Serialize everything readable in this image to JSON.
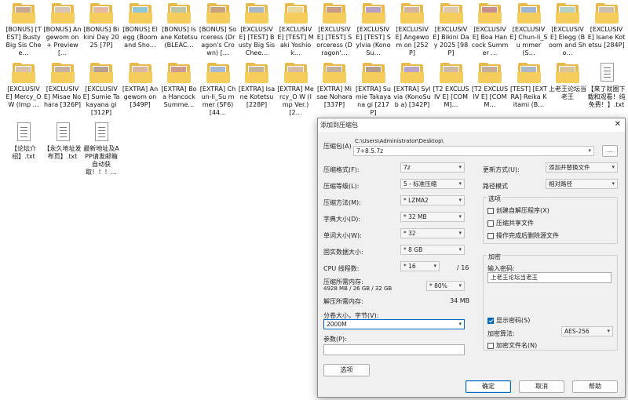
{
  "desktop": {
    "row1": [
      {
        "label": "[BONUS] [TEST] Busty Big Sis Chee…",
        "type": "folder",
        "photo": "#c9a993"
      },
      {
        "label": "[BONUS] Angewom on + Preview[…",
        "type": "folder",
        "photo": "#d7c4b6"
      },
      {
        "label": "[BONUS] Bikini Day 2025 [7P]",
        "type": "folder",
        "photo": "#e6b9a6"
      },
      {
        "label": "[BONUS] Elegg (Boom and Sho…",
        "type": "folder",
        "photo": "#8fc6d8"
      },
      {
        "label": "[BONUS] Isane Kotetsu (BLEAC…",
        "type": "folder",
        "photo": "#b9c7a8"
      },
      {
        "label": "[BONUS] Sorceress (Dragon's Crown) […",
        "type": "folder",
        "photo": "#c8a27f"
      },
      {
        "label": "[EXCLUSIV E] [TEST] Busty Big Sis Chee…",
        "type": "folder",
        "photo": "#a8b7c9"
      },
      {
        "label": "[EXCLUSIV E] [TEST] Maki Yoshiok…",
        "type": "folder",
        "photo": "#e9d7a0"
      },
      {
        "label": "[EXCLUSIV E] [TEST] Sorceress (Dragon'…",
        "type": "folder",
        "photo": "#c79a86"
      },
      {
        "label": "[EXCLUSIV E] [TEST] Sylvia (KonoSu…",
        "type": "folder",
        "photo": "#b7a0c6"
      },
      {
        "label": "[EXCLUSIV E] Angewom on [252P]",
        "type": "folder",
        "photo": "#d6b3a1"
      },
      {
        "label": "[EXCLUSIV E] Bikini Day 2025 [98P]",
        "type": "folder",
        "photo": "#e0c7b0"
      },
      {
        "label": "[EXCLUSIV E] Boa Hancock Summer …",
        "type": "folder",
        "photo": "#c98f8f"
      },
      {
        "label": "[EXCLUSIV E] Chun-li_Su mmer (S…",
        "type": "folder",
        "photo": "#9fb5d4"
      },
      {
        "label": "[EXCLUSIV E] Elegg (Boom and Sho…",
        "type": "folder",
        "photo": "#b4d2c8"
      },
      {
        "label": "[EXCLUSIV E] Isane Kotetsu [284P]",
        "type": "folder",
        "photo": "#cdbfae"
      }
    ],
    "row2": [
      {
        "label": "[EXCLUSIV E] Mercy_O W (Imp …",
        "type": "folder",
        "photo": "#d8c0a8"
      },
      {
        "label": "[EXCLUSIV E] Misae Nohara [326P]",
        "type": "folder",
        "photo": "#c6b1a0"
      },
      {
        "label": "[EXCLUSIV E] Sumie Takayana gi [312P]",
        "type": "folder",
        "photo": "#b79f94"
      },
      {
        "label": "[EXTRA] Angewom on [349P]",
        "type": "folder",
        "photo": "#d9b6a3"
      },
      {
        "label": "[EXTRA] Boa Hancock Summe…",
        "type": "folder",
        "photo": "#cc9a8e"
      },
      {
        "label": "[EXTRA] Chun-li_Su mmer (SF6) [44…",
        "type": "folder",
        "photo": "#a6b9d2"
      },
      {
        "label": "[EXTRA] Isane Kotetsu [228P]",
        "type": "folder",
        "photo": "#c3b49e"
      },
      {
        "label": "[EXTRA] Mercy_O W (Imp Ver.) [2…",
        "type": "folder",
        "photo": "#d4bca6"
      },
      {
        "label": "[EXTRA] Misae Nohara [337P]",
        "type": "folder",
        "photo": "#c2ad9c"
      },
      {
        "label": "[EXTRA] Sumie Takayana gi [217P]",
        "type": "folder",
        "photo": "#b59c90"
      },
      {
        "label": "[EXTRA] Sylvia (KonoSub a) [342P]",
        "type": "folder",
        "photo": "#b9a3c8"
      },
      {
        "label": "[T2 EXCLUSIV E] [COMM]…",
        "type": "folder",
        "photo": "#d0b9a4"
      },
      {
        "label": "[T2 EXCLUSIV E] [COMM…",
        "type": "folder",
        "photo": "#c8ac9a"
      },
      {
        "label": "[TEST] [EXTRA] Reika Kitami (B…",
        "type": "folder",
        "photo": "#aab8c6"
      },
      {
        "label": "上老王论坛当老王",
        "type": "folder",
        "photo": "#d9c39a"
      },
      {
        "label": "【来了就圈下载和观看！纯免费！】.txt",
        "type": "doc"
      }
    ],
    "row3": [
      {
        "label": "【论坛介绍】.txt",
        "type": "doc"
      },
      {
        "label": "【永久地址发布页】.txt",
        "type": "doc"
      },
      {
        "label": "最新地址及APP请发邮箱自动获取！！！…",
        "type": "doc"
      }
    ]
  },
  "dialog": {
    "title": "添加到压缩包",
    "close": "✕",
    "archive_label": "压缩包(A)",
    "archive_path": "C:\\Users\\Administrator\\Desktop\\",
    "archive_name": "7+8.5.7z",
    "browse": "...",
    "format_label": "压缩格式(F):",
    "format_value": "7z",
    "level_label": "压缩等级(L):",
    "level_value": "5 - 标准压缩",
    "method_label": "压缩方法(M):",
    "method_value": "*  LZMA2",
    "dict_label": "字典大小(D):",
    "dict_value": "*  32 MB",
    "word_label": "单词大小(W):",
    "word_value": "*  32",
    "solid_label": "固实数据大小:",
    "solid_value": "*  8 GB",
    "cpu_label": "CPU 线程数:",
    "cpu_value": "*  16",
    "cpu_total": "/ 16",
    "mem_comp_label": "压缩所需内存:",
    "mem_comp_value": "4928 MB / 26 GB / 32 GB",
    "mem_pct": "*  80%",
    "mem_decomp_label": "解压所需内存:",
    "mem_decomp_value": "34 MB",
    "split_label": "分卷大小，字节(V):",
    "split_value": "2000M",
    "params_label": "参数(P):",
    "params_value": "",
    "options_btn": "选项",
    "update_label": "更新方式(U):",
    "update_value": "添加并替换文件",
    "path_label": "路径模式",
    "path_value": "相对路径",
    "options_group": "选项",
    "opt_sfx": "创建自解压程序(X)",
    "opt_shared": "压缩共享文件",
    "opt_delete": "操作完成后删除源文件",
    "enc_group": "加密",
    "pwd_label": "输入密码:",
    "pwd_value": "上老王论坛当老王",
    "show_pwd": "显示密码(S)",
    "enc_method_label": "加密算法:",
    "enc_method_value": "AES-256",
    "enc_names": "加密文件名(N)",
    "ok": "确定",
    "cancel": "取消",
    "help": "帮助"
  }
}
